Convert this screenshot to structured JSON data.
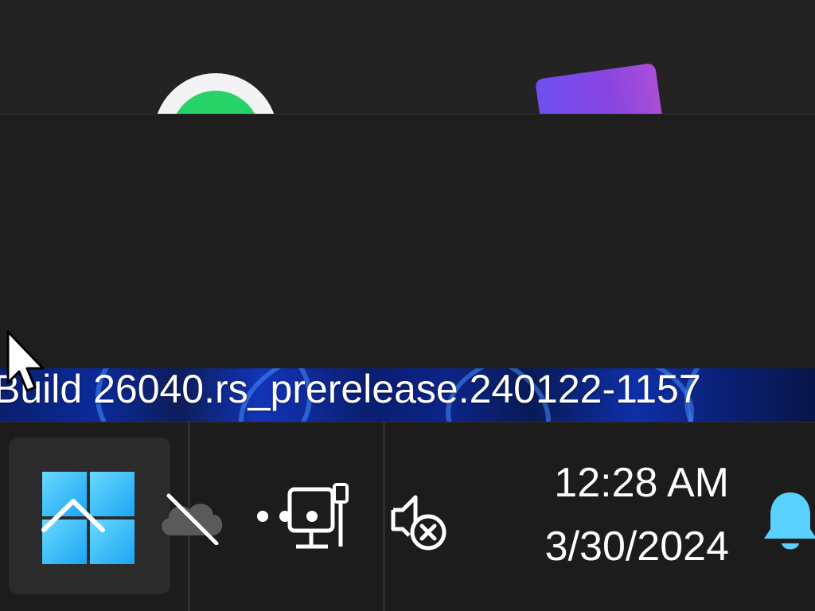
{
  "watermark": {
    "build_text": "Build 26040.rs_prerelease.240122-1157"
  },
  "apps": {
    "top_icons": [
      "whatsapp-icon",
      "purple-app-icon"
    ]
  },
  "taskbar": {
    "start_button_icon": "windows-logo-icon",
    "tray": {
      "overflow_icon": "chevron-up-icon",
      "onedrive_icon": "onedrive-off-icon",
      "network_icon": "ethernet-disconnected-icon",
      "volume_icon": "volume-muted-icon"
    },
    "clock": {
      "time": "12:28 AM",
      "date": "3/30/2024"
    },
    "notifications_icon": "bell-icon"
  },
  "colors": {
    "taskbar_bg": "#1c1c1c",
    "flyout_bg": "#1e1e1e",
    "accent_blue": "#4cc2ff",
    "bell_color": "#5ad0ff"
  }
}
